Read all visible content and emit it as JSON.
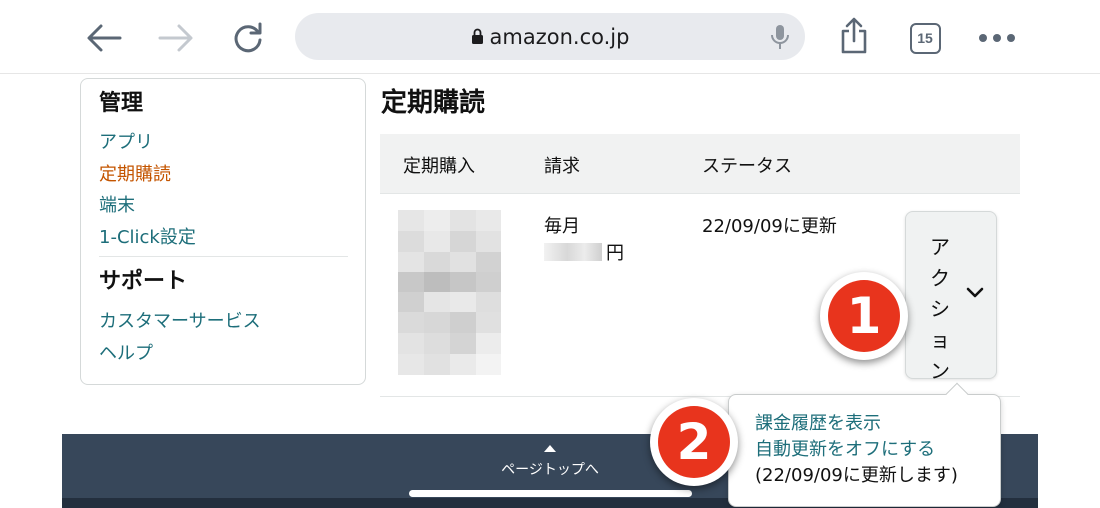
{
  "browser": {
    "url": "amazon.co.jp",
    "tab_count": "15"
  },
  "sidebar": {
    "heading_manage": "管理",
    "items": [
      {
        "label": "アプリ",
        "active": false
      },
      {
        "label": "定期購読",
        "active": true
      },
      {
        "label": "端末",
        "active": false
      },
      {
        "label": "1-Click設定",
        "active": false
      }
    ],
    "heading_support": "サポート",
    "support_items": [
      {
        "label": "カスタマーサービス"
      },
      {
        "label": "ヘルプ"
      }
    ]
  },
  "main": {
    "title": "定期購読",
    "columns": [
      "定期購入",
      "請求",
      "ステータス"
    ],
    "row": {
      "billing_frequency": "毎月",
      "currency_suffix": "円",
      "status": "22/09/09に更新",
      "action_label": "アクション"
    }
  },
  "popover": {
    "items": [
      "課金履歴を表示",
      "自動更新をオフにする"
    ],
    "note": "(22/09/09に更新します)"
  },
  "footer": {
    "back_to_top": "ページトップへ"
  },
  "badges": {
    "step1": "1",
    "step2": "2"
  },
  "colors": {
    "link": "#1d6e7a",
    "active_link": "#c45500",
    "footer_bg": "#37475a",
    "badge_red": "#e8341d"
  }
}
